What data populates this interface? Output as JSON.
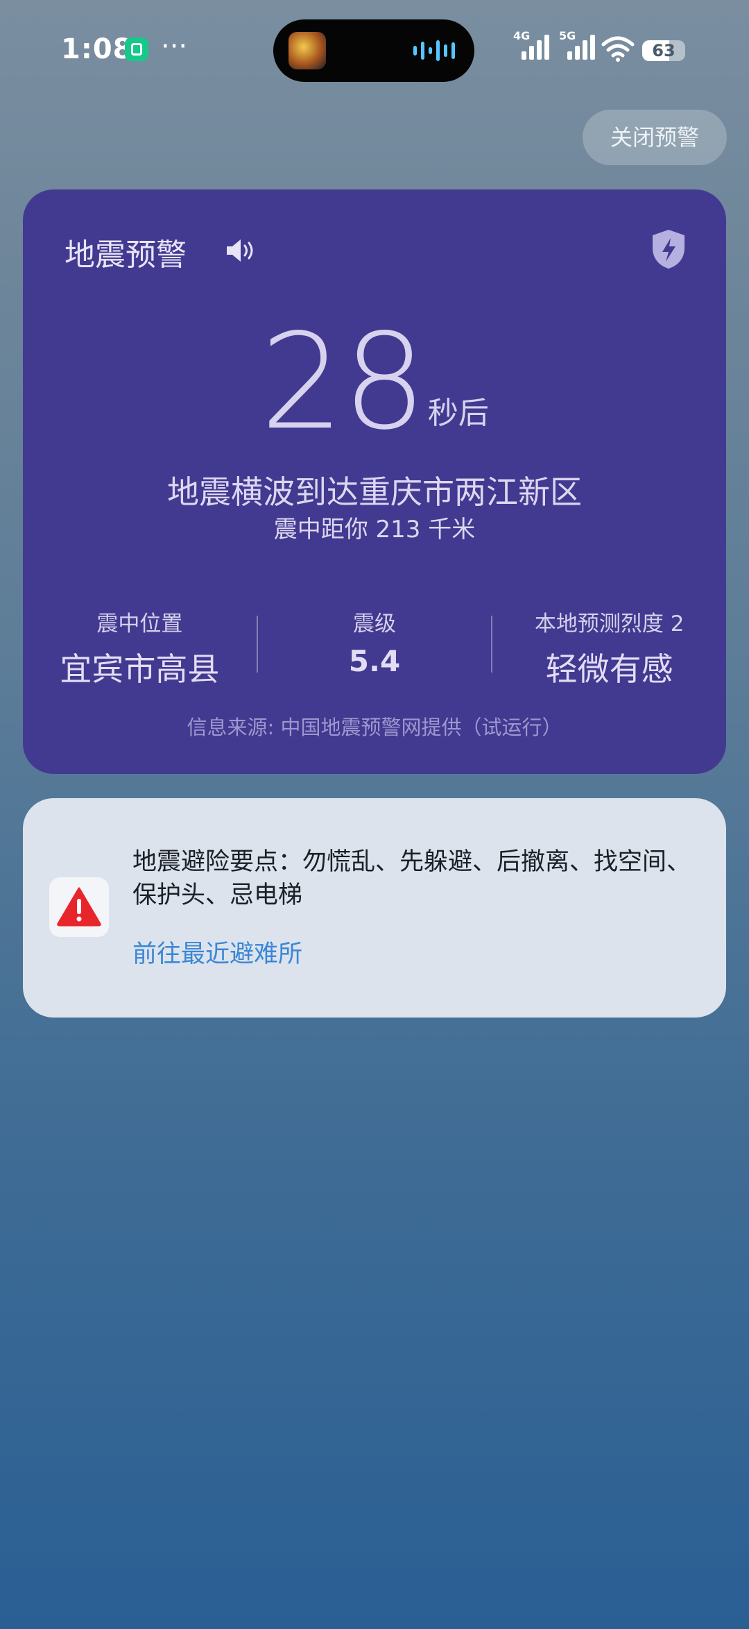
{
  "status_bar": {
    "time": "1:08",
    "overflow": "···",
    "signal1_label": "4G",
    "signal2_label": "5G",
    "battery_level": "63",
    "accent": "#16c98a"
  },
  "alert": {
    "close_button": "关闭预警",
    "title": "地震预警",
    "countdown": "28",
    "countdown_unit": "秒后",
    "arrival_text": "地震横波到达重庆市两江新区",
    "distance_text": "震中距你 213 千米",
    "stats": [
      {
        "label": "震中位置",
        "value": "宜宾市高县"
      },
      {
        "label": "震级",
        "value": "5.4"
      },
      {
        "label": "本地预测烈度  2",
        "value": "轻微有感"
      }
    ],
    "source": "信息来源:  中国地震预警网提供（试运行）",
    "card_color": "#423a90"
  },
  "tips": {
    "text": "地震避险要点：勿慌乱、先躲避、后撤离、找空间、保护头、忌电梯",
    "link": "前往最近避难所",
    "link_color": "#3a86d6"
  },
  "icons": [
    "mi-home-icon",
    "app-thumbnail-icon",
    "audio-wave-icon",
    "signal-icon",
    "wifi-icon",
    "battery-icon",
    "speaker-icon",
    "shield-bolt-icon",
    "warning-triangle-icon"
  ]
}
